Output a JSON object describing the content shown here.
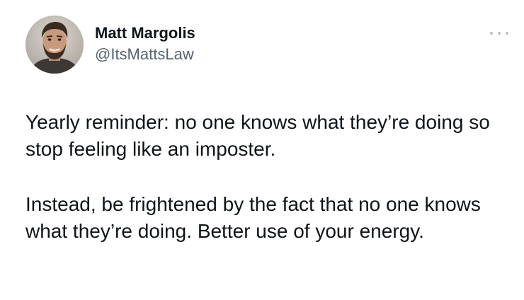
{
  "author": {
    "display_name": "Matt Margolis",
    "handle": "@ItsMattsLaw",
    "avatar_icon": "profile-photo"
  },
  "more_menu": {
    "icon": "more-options-icon"
  },
  "tweet": {
    "paragraphs": [
      "Yearly reminder: no one knows what they’re doing so stop feeling like an imposter.",
      "Instead, be frightened by the fact that no one knows what they’re doing. Better use of your energy."
    ]
  },
  "colors": {
    "text_primary": "#0f1419",
    "text_secondary": "#536471",
    "background": "#ffffff"
  }
}
